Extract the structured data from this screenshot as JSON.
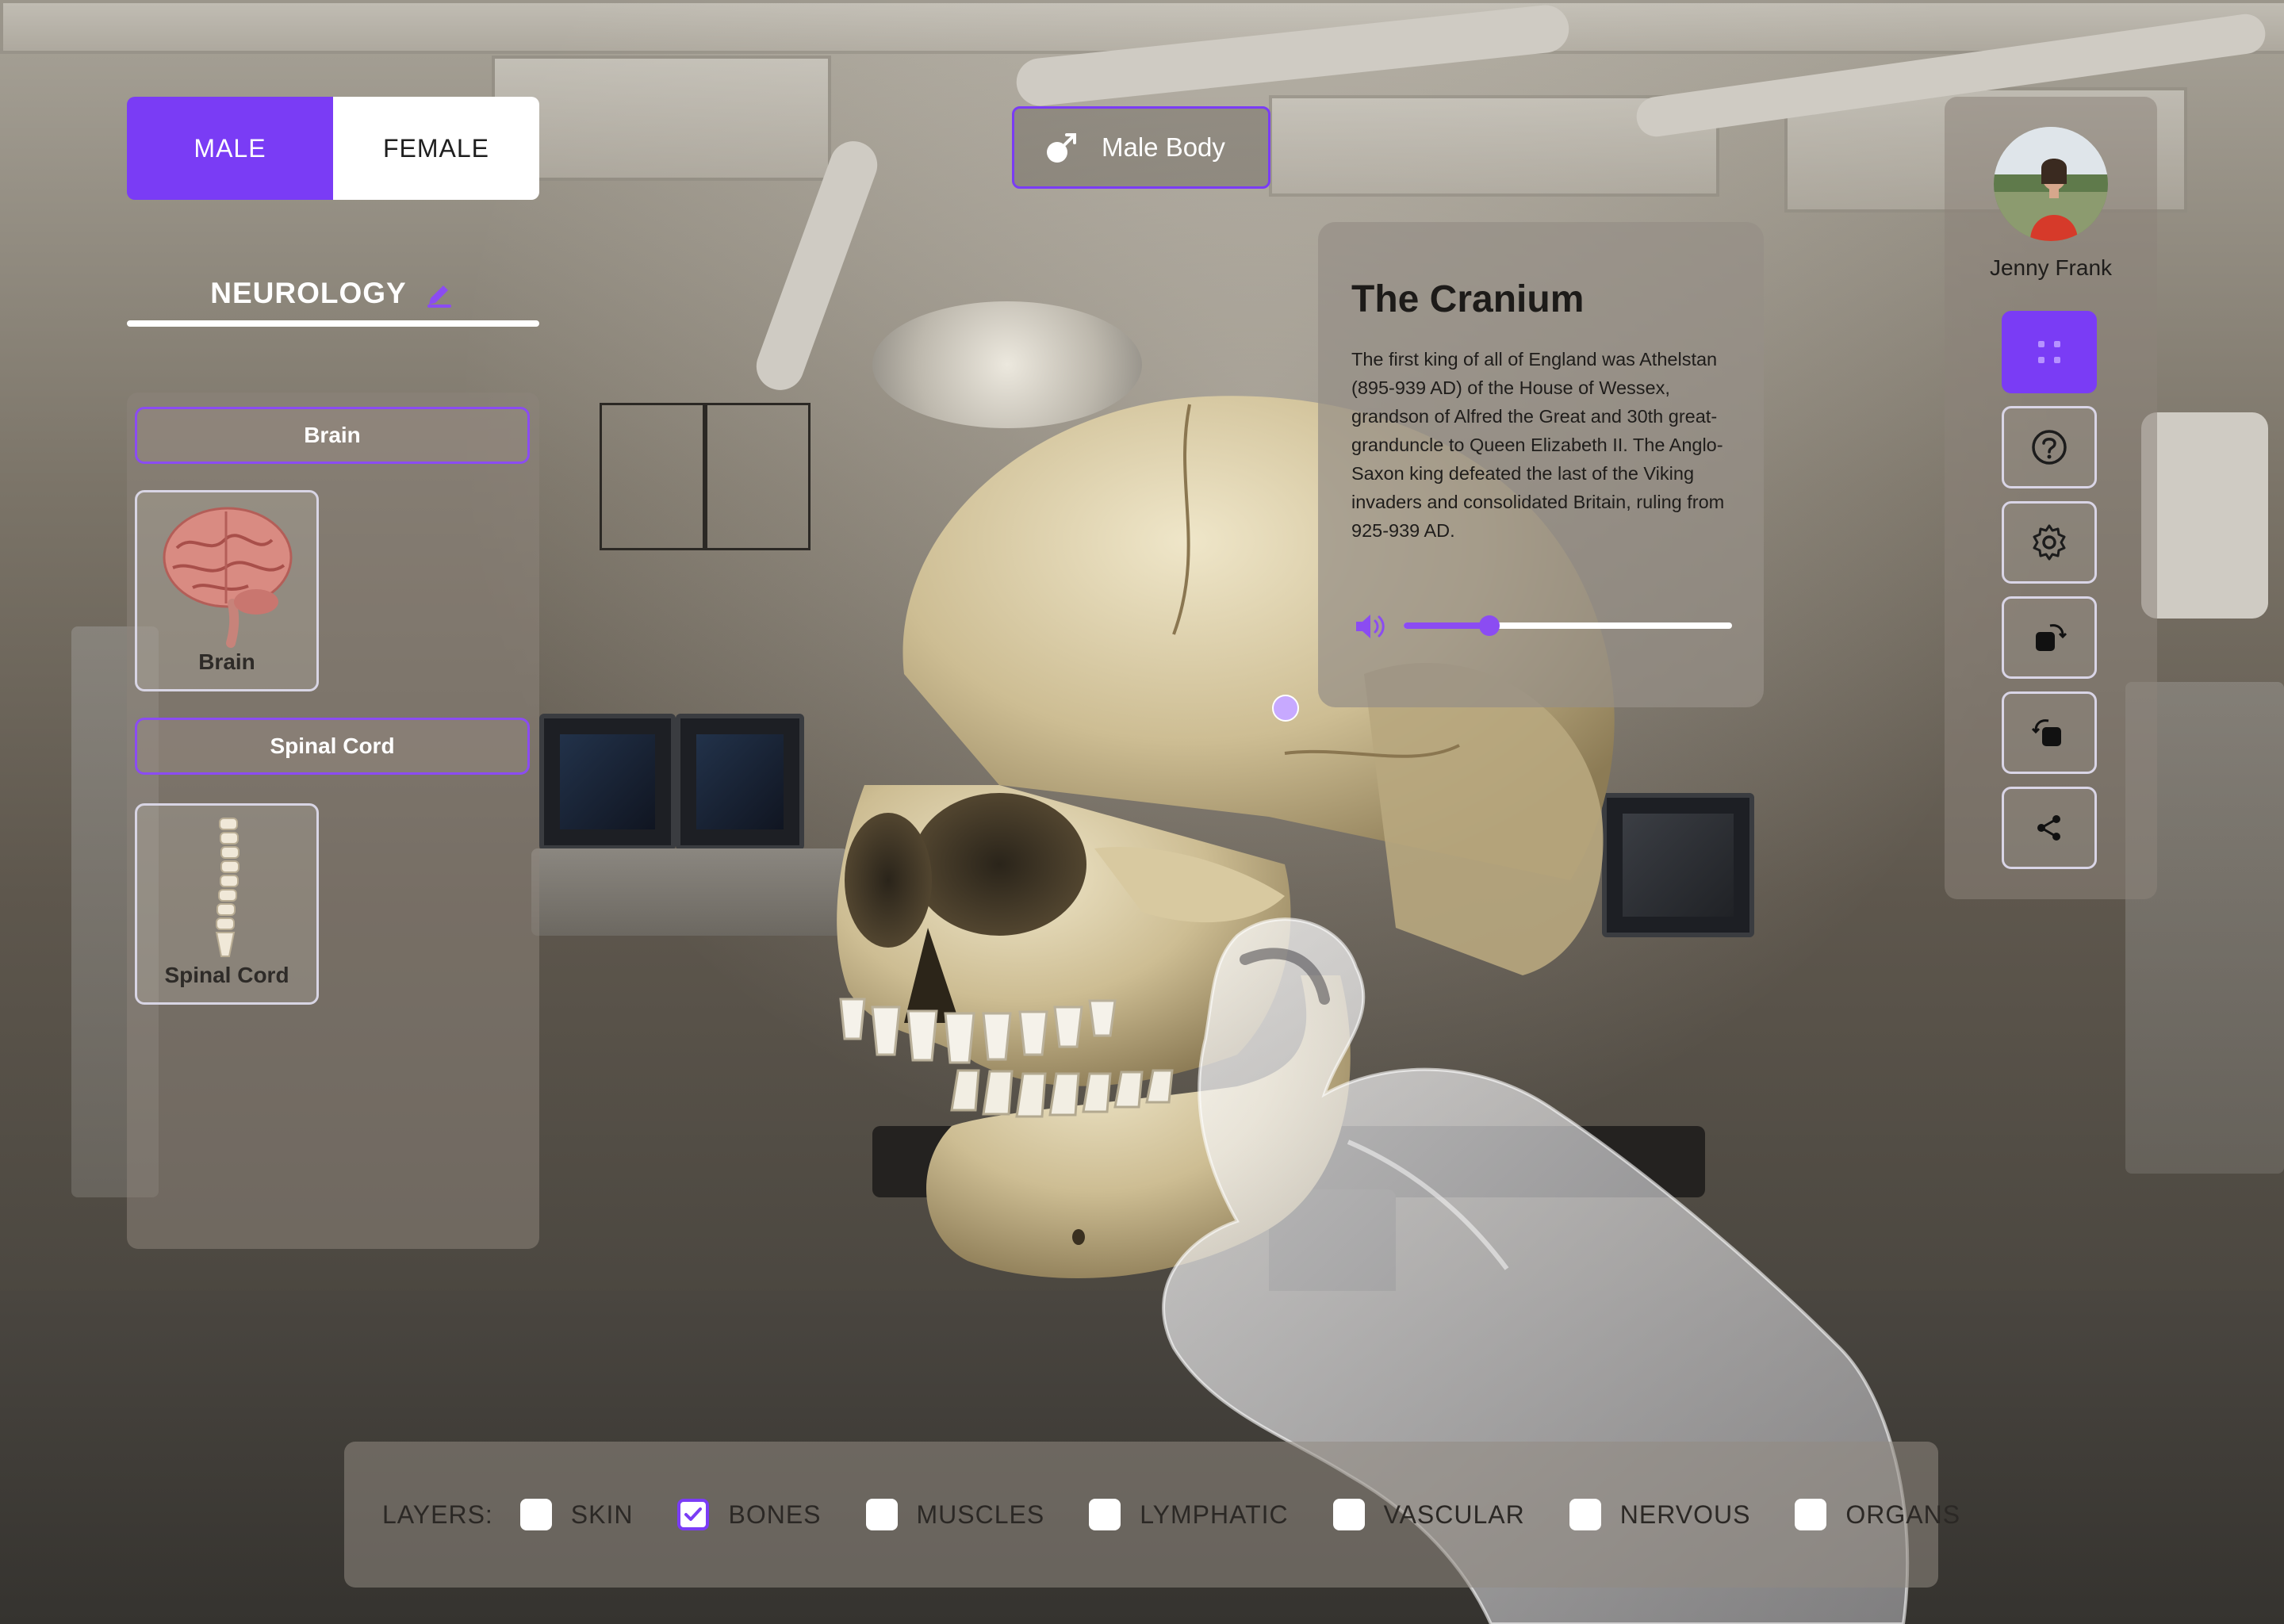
{
  "gender": {
    "male_label": "MALE",
    "female_label": "FEMALE",
    "selected": "male"
  },
  "section": {
    "title": "NEUROLOGY"
  },
  "body_tag": {
    "label": "Male Body"
  },
  "categories": [
    {
      "header": "Brain",
      "item_label": "Brain"
    },
    {
      "header": "Spinal Cord",
      "item_label": "Spinal Cord"
    }
  ],
  "info": {
    "title": "The Cranium",
    "body": "The first king of all of England was Athelstan (895-939 AD) of the House of Wessex, grandson of Alfred the Great and 30th great-granduncle to Queen Elizabeth II. The Anglo-Saxon king defeated the last of the Viking invaders and consolidated Britain, ruling from 925-939 AD.",
    "audio_progress": 0.26
  },
  "user": {
    "name": "Jenny Frank"
  },
  "tools": [
    "grid-icon",
    "help-icon",
    "gear-icon",
    "rotate-right-icon",
    "rotate-left-icon",
    "share-icon"
  ],
  "layers": {
    "label": "LAYERS:",
    "items": [
      {
        "label": "SKIN",
        "checked": false
      },
      {
        "label": "BONES",
        "checked": true
      },
      {
        "label": "MUSCLES",
        "checked": false
      },
      {
        "label": "LYMPHATIC",
        "checked": false
      },
      {
        "label": "VASCULAR",
        "checked": false
      },
      {
        "label": "NERVOUS",
        "checked": false
      },
      {
        "label": "ORGANS",
        "checked": false
      }
    ]
  },
  "colors": {
    "accent": "#7a3cf5",
    "accent_light": "#8b4cf2"
  }
}
